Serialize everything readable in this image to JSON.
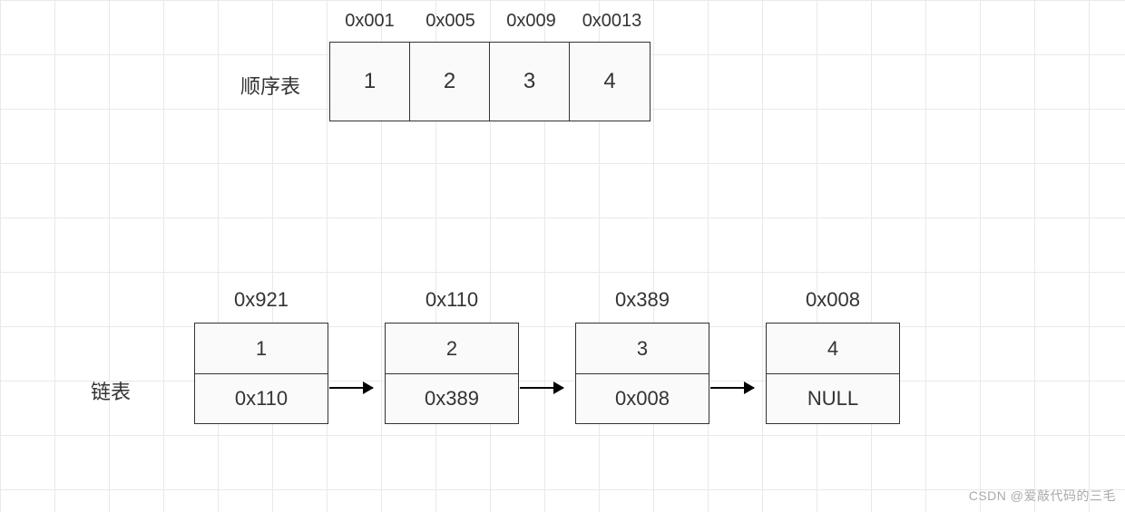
{
  "labels": {
    "array": "顺序表",
    "linked_list": "链表"
  },
  "array": {
    "addresses": [
      "0x001",
      "0x005",
      "0x009",
      "0x0013"
    ],
    "values": [
      "1",
      "2",
      "3",
      "4"
    ]
  },
  "linked_list": {
    "nodes": [
      {
        "addr": "0x921",
        "val": "1",
        "next": "0x110"
      },
      {
        "addr": "0x110",
        "val": "2",
        "next": "0x389"
      },
      {
        "addr": "0x389",
        "val": "3",
        "next": "0x008"
      },
      {
        "addr": "0x008",
        "val": "4",
        "next": "NULL"
      }
    ]
  },
  "watermark": "CSDN @爱敲代码的三毛"
}
